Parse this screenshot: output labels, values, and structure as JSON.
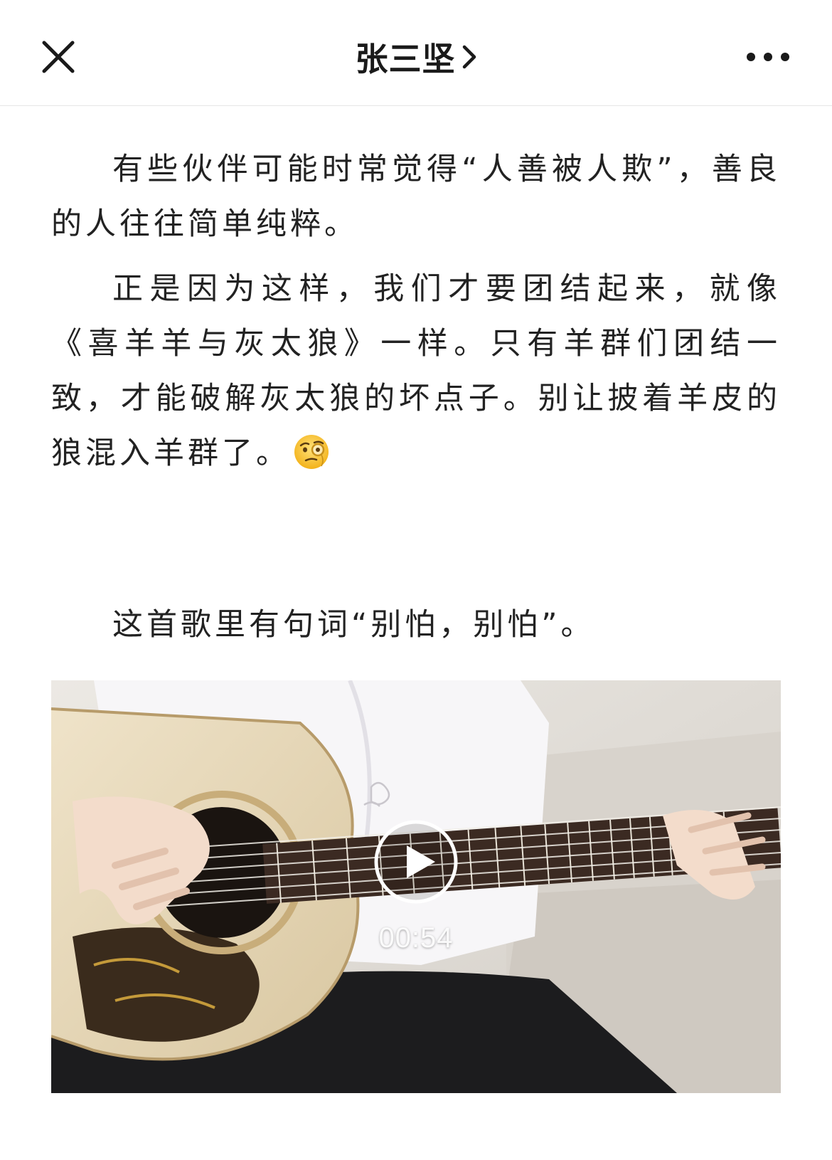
{
  "navbar": {
    "title": "张三坚",
    "close_icon": "close-icon",
    "chevron_icon": "chevron-right-icon",
    "more_icon": "more-dots-icon"
  },
  "article": {
    "paragraphs": [
      "有些伙伴可能时常觉得“人善被人欺”，善良的人往往简单纯粹。",
      "正是因为这样，我们才要团结起来，就像《喜羊羊与灰太狼》一样。只有羊群们团结一致，才能破解灰太狼的坏点子。别让披着羊皮的狼混入羊群了。",
      "这首歌里有句词“别怕，别怕”。"
    ],
    "emoji": "face-with-monocle-emoji"
  },
  "video": {
    "duration": "00:54",
    "play_icon": "play-icon"
  },
  "colors": {
    "text": "#222222",
    "divider": "#e6e6e6",
    "background": "#ffffff"
  }
}
